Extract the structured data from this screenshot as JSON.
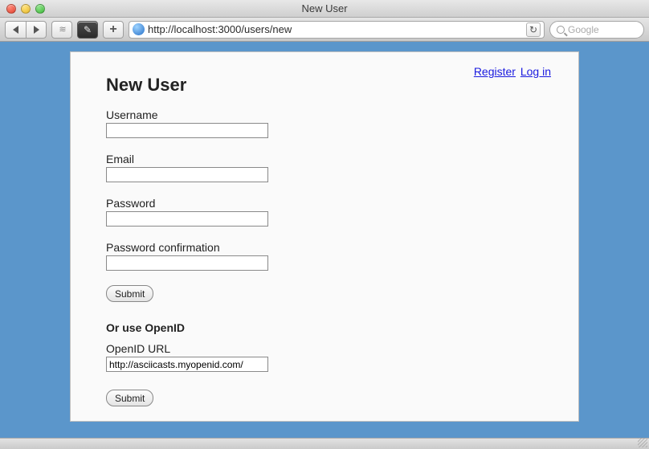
{
  "window": {
    "title": "New User"
  },
  "toolbar": {
    "url": "http://localhost:3000/users/new",
    "search_placeholder": "Google"
  },
  "nav": {
    "register_label": "Register",
    "login_label": "Log in"
  },
  "form": {
    "heading": "New User",
    "username": {
      "label": "Username",
      "value": ""
    },
    "email": {
      "label": "Email",
      "value": ""
    },
    "password": {
      "label": "Password",
      "value": ""
    },
    "password_confirmation": {
      "label": "Password confirmation",
      "value": ""
    },
    "submit_label": "Submit",
    "openid": {
      "heading": "Or use OpenID",
      "label": "OpenID URL",
      "value": "http://asciicasts.myopenid.com/",
      "submit_label": "Submit"
    }
  }
}
